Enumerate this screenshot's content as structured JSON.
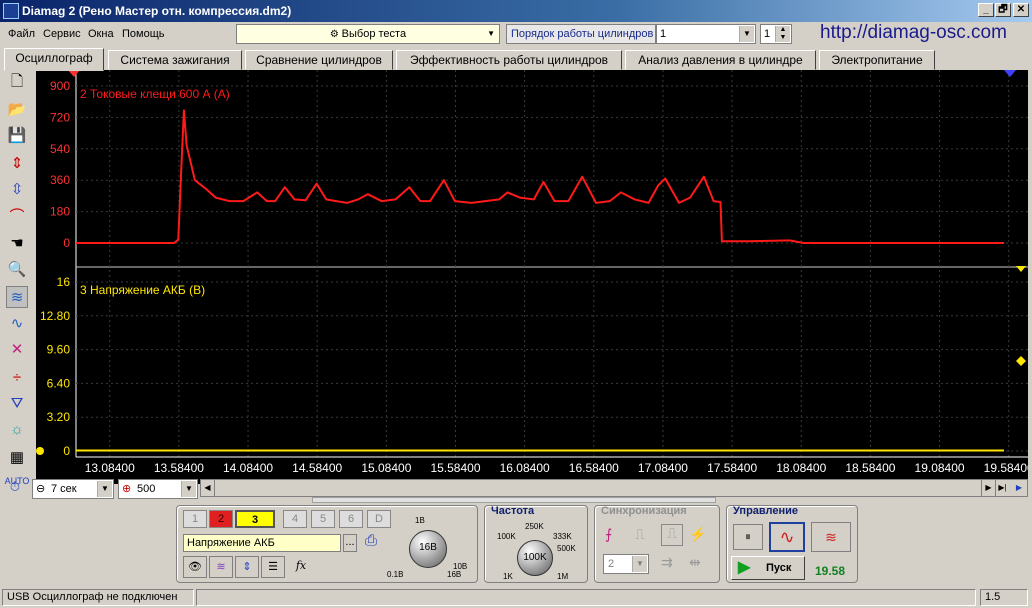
{
  "window": {
    "title": "Diamag 2 (Рено Мастер отн. компрессия.dm2)",
    "min": "_",
    "max": "🗗",
    "close": "✕"
  },
  "menu": [
    "Файл",
    "Сервис",
    "Окна",
    "Помощь"
  ],
  "test_select": {
    "value": "Выбор теста"
  },
  "cyl_order": {
    "label": "Порядок работы цилиндров",
    "value": "1",
    "stepper": "1"
  },
  "url": "http://diamag-osc.com",
  "tabs": [
    "Осциллограф",
    "Система зажигания",
    "Сравнение цилиндров",
    "Эффективность работы цилиндров",
    "Анализ давления в цилиндре",
    "Электропитание"
  ],
  "chart_data": [
    {
      "type": "line",
      "title": "2 Токовые клещи 600 А (А)",
      "yticks": [
        "900",
        "720",
        "540",
        "360",
        "180",
        "0"
      ],
      "ylim": [
        0,
        900
      ],
      "color": "#ff1a1a",
      "x": [
        12.84,
        13.55,
        13.58,
        13.6,
        13.62,
        13.64,
        13.7,
        13.78,
        13.85,
        13.95,
        14.05,
        14.15,
        14.22,
        14.28,
        14.35,
        14.42,
        14.5,
        14.58,
        14.65,
        14.72,
        14.8,
        14.88,
        14.95,
        15.05,
        15.15,
        15.25,
        15.33,
        15.4,
        15.5,
        15.58,
        15.7,
        15.8,
        15.9,
        15.96,
        16.05,
        16.15,
        16.22,
        16.3,
        16.4,
        16.5,
        16.6,
        16.7,
        16.78,
        16.88,
        16.98,
        17.05,
        17.1,
        17.2,
        17.28,
        17.38,
        17.45,
        17.5,
        17.51,
        17.55,
        17.7,
        18.0,
        18.1,
        19.55
      ],
      "y": [
        0,
        0,
        20,
        400,
        760,
        560,
        360,
        310,
        260,
        240,
        240,
        290,
        240,
        240,
        320,
        250,
        245,
        340,
        250,
        240,
        230,
        250,
        280,
        240,
        250,
        320,
        240,
        240,
        360,
        240,
        230,
        240,
        250,
        290,
        260,
        250,
        350,
        240,
        240,
        380,
        230,
        240,
        290,
        250,
        230,
        330,
        370,
        230,
        260,
        380,
        240,
        235,
        10,
        10,
        10,
        15,
        0,
        0
      ]
    },
    {
      "type": "line",
      "title": "3 Напряжение АКБ (В)",
      "yticks": [
        "16",
        "12.80",
        "9.60",
        "6.40",
        "3.20",
        "0"
      ],
      "ylim": [
        0,
        16
      ],
      "color": "#ffe600",
      "x": [
        12.84,
        19.55
      ],
      "y": [
        0.05,
        0.05
      ]
    }
  ],
  "x_axis": {
    "ticks": [
      "13.08400",
      "13.58400",
      "14.08400",
      "14.58400",
      "15.08400",
      "15.58400",
      "16.08400",
      "16.58400",
      "17.08400",
      "17.58400",
      "18.08400",
      "18.58400",
      "19.08400",
      "19.58400"
    ]
  },
  "timebase": {
    "value": "7 сек"
  },
  "points": {
    "value": "500"
  },
  "channels": {
    "buttons": [
      "1",
      "2",
      "3",
      "4",
      "5",
      "6",
      "D"
    ],
    "active": "3",
    "name": "Напряжение АКБ",
    "name_btn": "..."
  },
  "voltage_knob": {
    "value": "16В",
    "min": "0.1В",
    "max": "16В",
    "top": "1В",
    "right": "10В"
  },
  "frequency": {
    "title": "Частота",
    "value": "100K",
    "labels": [
      "100K",
      "250K",
      "333K",
      "500K",
      "1K",
      "1M"
    ]
  },
  "sync": {
    "title": "Синхронизация",
    "value": "2"
  },
  "control": {
    "title": "Управление",
    "start": "Пуск",
    "fps": "19.58"
  },
  "status": {
    "left": "USB Осциллограф не подключен",
    "right": "1.5"
  },
  "colors": {
    "ch2": "#ff1a1a",
    "ch3": "#ffe600",
    "active_channel": "#ffff00",
    "channel2_btn": "#e02020"
  }
}
